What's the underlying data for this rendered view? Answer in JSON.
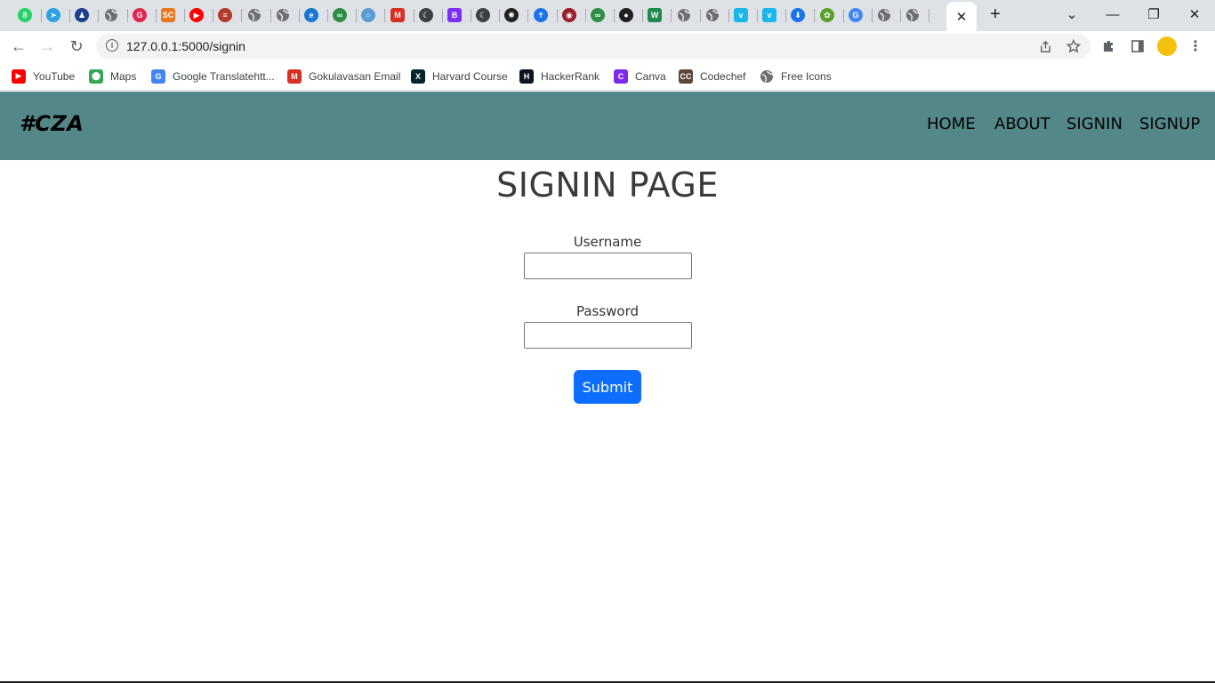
{
  "browser": {
    "tabs": [
      {
        "icon": "whatsapp-icon",
        "glyph": "8",
        "color": "#25d366"
      },
      {
        "icon": "telegram-icon",
        "glyph": "➤",
        "color": "#2aa3e0"
      },
      {
        "icon": "person-icon",
        "glyph": "♟",
        "color": "#1d3f8f"
      },
      {
        "icon": "globe-icon",
        "glyph": "",
        "color": "#6d6f73"
      },
      {
        "icon": "grammarly-icon",
        "glyph": "G",
        "color": "#e0264b"
      },
      {
        "icon": "sc-icon",
        "glyph": "SC",
        "color": "#e87722"
      },
      {
        "icon": "youtube-icon",
        "glyph": "▶",
        "color": "#ff0000"
      },
      {
        "icon": "document-icon",
        "glyph": "≡",
        "color": "#b33a2b"
      },
      {
        "icon": "globe-icon",
        "glyph": "",
        "color": "#6d6f73"
      },
      {
        "icon": "globe-icon",
        "glyph": "",
        "color": "#6d6f73"
      },
      {
        "icon": "edge-icon",
        "glyph": "e",
        "color": "#1976d2"
      },
      {
        "icon": "geeksforgeeks-icon",
        "glyph": "∞",
        "color": "#2f8d46"
      },
      {
        "icon": "loop-icon",
        "glyph": "○",
        "color": "#5b9bd5"
      },
      {
        "icon": "gmail-icon",
        "glyph": "M",
        "color": "#d93025"
      },
      {
        "icon": "moon-icon",
        "glyph": "☾",
        "color": "#3c4043"
      },
      {
        "icon": "bootstrap-icon",
        "glyph": "B",
        "color": "#7b2ff7"
      },
      {
        "icon": "moon-icon",
        "glyph": "☾",
        "color": "#3c4043"
      },
      {
        "icon": "openai-icon",
        "glyph": "✺",
        "color": "#202124"
      },
      {
        "icon": "cross-icon",
        "glyph": "✝",
        "color": "#1a73e8"
      },
      {
        "icon": "university-icon",
        "glyph": "◉",
        "color": "#9c1c2b"
      },
      {
        "icon": "geeksforgeeks-icon",
        "glyph": "∞",
        "color": "#2f8d46"
      },
      {
        "icon": "github-icon",
        "glyph": "●",
        "color": "#202124"
      },
      {
        "icon": "w-icon",
        "glyph": "W",
        "color": "#1e8a4c"
      },
      {
        "icon": "globe-icon",
        "glyph": "",
        "color": "#6d6f73"
      },
      {
        "icon": "globe-icon",
        "glyph": "",
        "color": "#6d6f73"
      },
      {
        "icon": "vimeo-icon",
        "glyph": "v",
        "color": "#1ab7ea"
      },
      {
        "icon": "vimeo-icon",
        "glyph": "v",
        "color": "#1ab7ea"
      },
      {
        "icon": "download-icon",
        "glyph": "⬇",
        "color": "#1a73e8"
      },
      {
        "icon": "leaf-icon",
        "glyph": "✿",
        "color": "#5aa02c"
      },
      {
        "icon": "google-icon",
        "glyph": "G",
        "color": "#4285f4"
      },
      {
        "icon": "globe-icon",
        "glyph": "",
        "color": "#6d6f73"
      },
      {
        "icon": "globe-icon",
        "glyph": "",
        "color": "#6d6f73"
      }
    ],
    "active_tab_close": "✕",
    "new_tab": "+",
    "tab_search": "⌄",
    "window_controls": {
      "minimize": "—",
      "restore": "❐",
      "close": "✕"
    },
    "nav": {
      "back": "←",
      "forward": "→",
      "reload": "↻"
    },
    "address": "127.0.0.1:5000/signin",
    "bookmarks": [
      {
        "label": "YouTube",
        "icon": "youtube-icon",
        "glyph": "▶",
        "color": "#ff0000"
      },
      {
        "label": "Maps",
        "icon": "maps-icon",
        "glyph": "⬤",
        "color": "#34a853"
      },
      {
        "label": "Google Translatehtt...",
        "icon": "translate-icon",
        "glyph": "G",
        "color": "#4285f4"
      },
      {
        "label": "Gokulavasan Email",
        "icon": "gmail-icon",
        "glyph": "M",
        "color": "#d93025"
      },
      {
        "label": "Harvard Course",
        "icon": "edx-icon",
        "glyph": "X",
        "color": "#02262b"
      },
      {
        "label": "HackerRank",
        "icon": "hackerrank-icon",
        "glyph": "H",
        "color": "#0e141e"
      },
      {
        "label": "Canva",
        "icon": "canva-icon",
        "glyph": "C",
        "color": "#7d2ae8"
      },
      {
        "label": "Codechef",
        "icon": "codechef-icon",
        "glyph": "CC",
        "color": "#5b4638"
      },
      {
        "label": "Free Icons",
        "icon": "globe-icon",
        "glyph": "",
        "color": "#6d6f73"
      }
    ]
  },
  "site": {
    "brand": "#CZA",
    "nav": [
      "HOME",
      "ABOUT",
      "SIGNIN",
      "SIGNUP"
    ],
    "colors": {
      "navbar": "#548888",
      "button": "#0d6efd"
    }
  },
  "signin": {
    "title": "SIGNIN PAGE",
    "username_label": "Username",
    "username_value": "",
    "password_label": "Password",
    "password_value": "",
    "submit_label": "Submit"
  }
}
